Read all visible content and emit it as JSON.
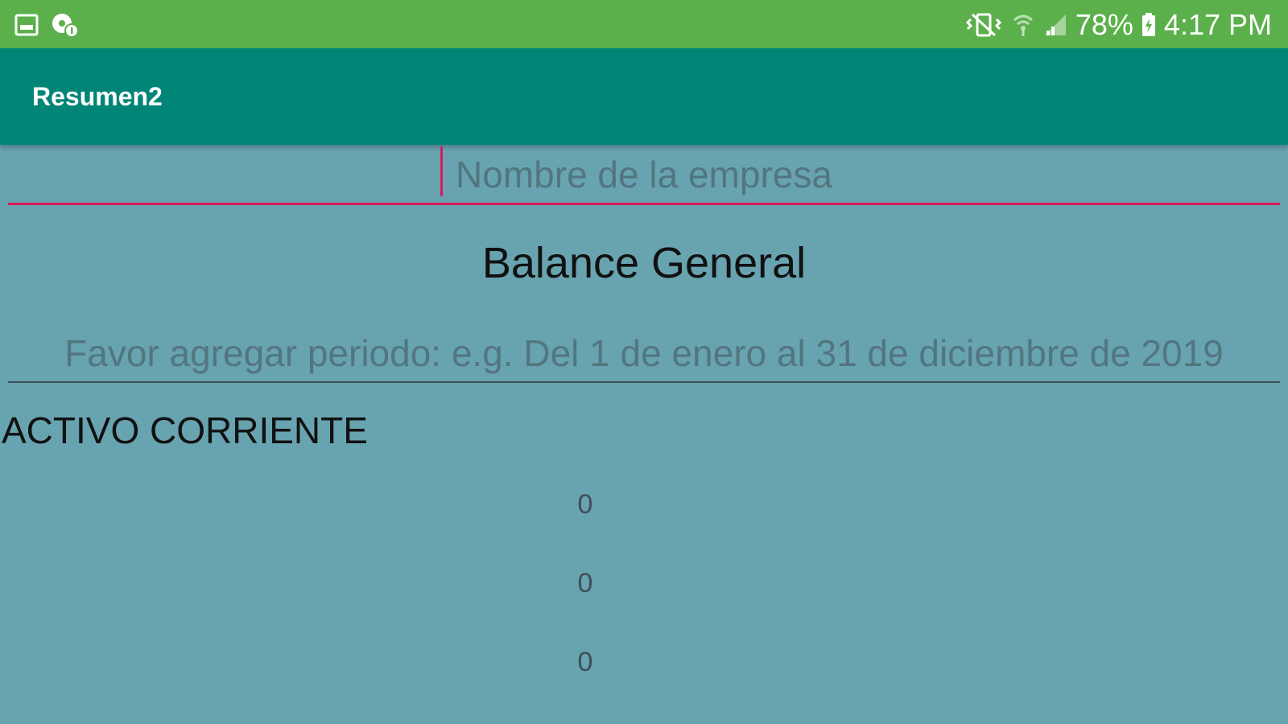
{
  "status_bar": {
    "battery": "78%",
    "time": "4:17 PM",
    "icons": [
      "gallery-icon",
      "settings-badge-icon",
      "mute-vibrate-icon",
      "wifi-icon",
      "signal-icon",
      "battery-charging-icon"
    ]
  },
  "app_bar": {
    "title": "Resumen2"
  },
  "form": {
    "company_placeholder": "Nombre de la empresa",
    "period_placeholder": "Favor agregar periodo: e.g. Del 1 de enero al 31 de diciembre de 2019"
  },
  "main": {
    "title": "Balance General",
    "section": "ACTIVO CORRIENTE",
    "values": [
      "0",
      "0",
      "0"
    ]
  },
  "colors": {
    "status_bar": "#5bb04b",
    "app_bar": "#018577",
    "background": "#68a3b0",
    "accent": "#d81b60"
  }
}
